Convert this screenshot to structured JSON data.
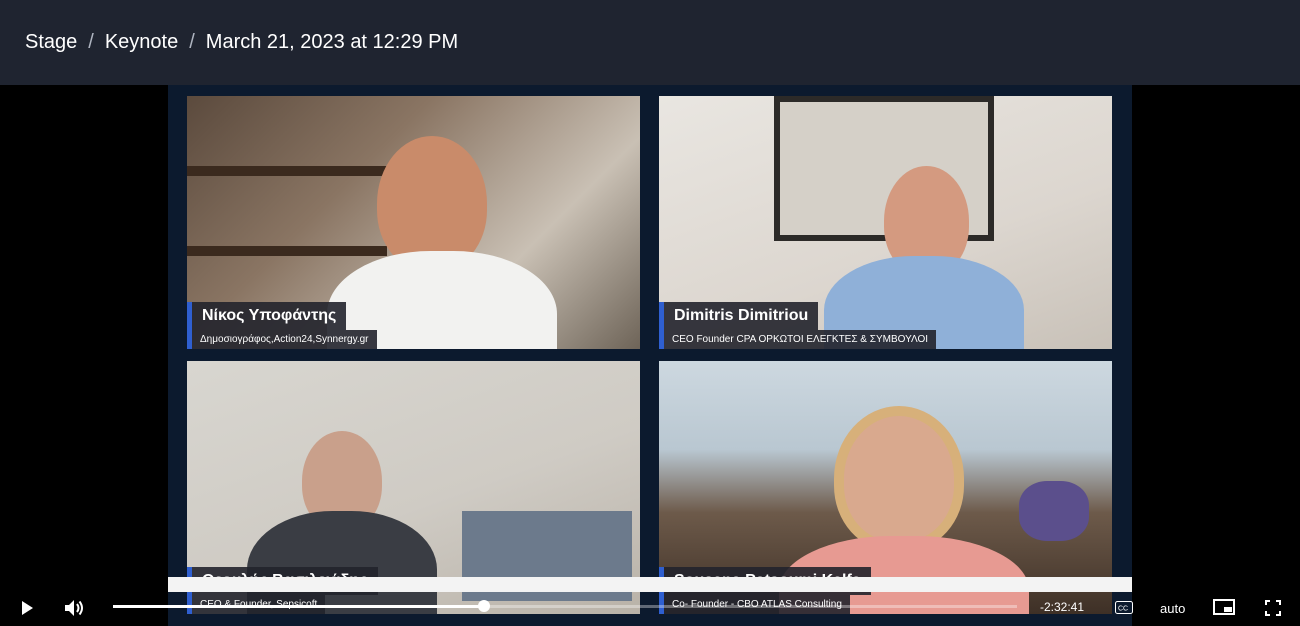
{
  "breadcrumb": {
    "items": [
      "Stage",
      "Keynote",
      "March 21, 2023 at 12:29 PM"
    ],
    "separator": "/"
  },
  "participants": [
    {
      "name": "Νίκος Υποφάντης",
      "role": "Δημοσιογράφος,Action24,Synnergy.gr"
    },
    {
      "name": "Dimitris Dimitriou",
      "role": "CEO Founder CPA ΟΡΚΩΤΟΙ ΕΛΕΓΚΤΕΣ & ΣΥΜΒΟΥΛΟΙ"
    },
    {
      "name": "Θεοκλής Βασιλειάδης",
      "role": "CEO & Founder, Sepsicoft"
    },
    {
      "name": "Sousana Patsoumi Kalfa",
      "role": "Co- Founder - CBO ATLAS Consulting"
    }
  ],
  "player": {
    "time_remaining": "-2:32:41",
    "quality": "auto",
    "progress": 0.41,
    "icons": {
      "play": "play-icon",
      "volume": "volume-icon",
      "captions": "captions-icon",
      "pip": "picture-in-picture-icon",
      "fullscreen": "fullscreen-icon"
    }
  },
  "colors": {
    "topbar": "#1f2430",
    "accent": "#2f5fd0"
  }
}
